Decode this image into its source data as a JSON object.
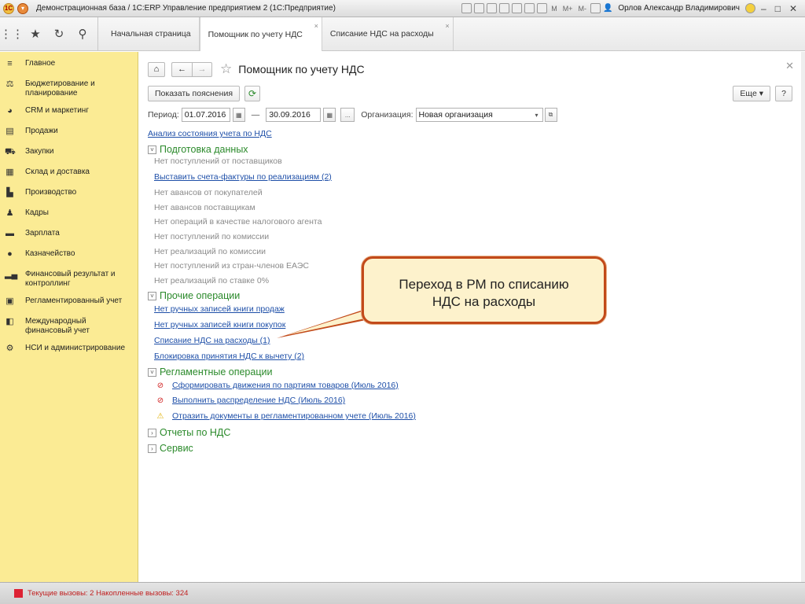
{
  "titlebar": {
    "title": "Демонстрационная база / 1С:ERP Управление предприятием 2  (1С:Предприятие)",
    "mem_labels": [
      "M",
      "M+",
      "M-"
    ],
    "user": "Орлов Александр Владимирович"
  },
  "tabs": [
    {
      "label": "Начальная страница"
    },
    {
      "label": "Помощник по учету НДС"
    },
    {
      "label": "Списание НДС на расходы"
    }
  ],
  "sidebar": {
    "items": [
      {
        "label": "Главное",
        "icon": "menu-icon"
      },
      {
        "label": "Бюджетирование и планирование",
        "icon": "budget-icon"
      },
      {
        "label": "CRM и маркетинг",
        "icon": "crm-icon"
      },
      {
        "label": "Продажи",
        "icon": "sales-icon"
      },
      {
        "label": "Закупки",
        "icon": "cart-icon"
      },
      {
        "label": "Склад и доставка",
        "icon": "warehouse-icon"
      },
      {
        "label": "Производство",
        "icon": "factory-icon"
      },
      {
        "label": "Кадры",
        "icon": "person-icon"
      },
      {
        "label": "Зарплата",
        "icon": "salary-icon"
      },
      {
        "label": "Казначейство",
        "icon": "treasury-icon"
      },
      {
        "label": "Финансовый результат и контроллинг",
        "icon": "chart-icon"
      },
      {
        "label": "Регламентированный учет",
        "icon": "calculator-icon"
      },
      {
        "label": "Международный финансовый учет",
        "icon": "ledger-icon"
      },
      {
        "label": "НСИ и администрирование",
        "icon": "gear-icon"
      }
    ]
  },
  "page": {
    "title": "Помощник по учету НДС",
    "show_hints_button": "Показать пояснения",
    "more_button": "Еще",
    "help_button": "?",
    "period_label": "Период:",
    "period_from": "01.07.2016",
    "period_dash": "—",
    "period_to": "30.09.2016",
    "period_more": "...",
    "org_label": "Организация:",
    "org_value": "Новая организация",
    "analysis_link": "Анализ состояния учета по НДС"
  },
  "groups": {
    "prep": {
      "title": "Подготовка данных",
      "items": [
        {
          "text": "Нет поступлений от поставщиков",
          "link": false
        },
        {
          "text": "Выставить счета-фактуры по реализациям (2)",
          "link": true
        },
        {
          "text": "Нет авансов от покупателей",
          "link": false
        },
        {
          "text": "Нет авансов поставщикам",
          "link": false
        },
        {
          "text": "Нет операций в качестве налогового агента",
          "link": false
        },
        {
          "text": "Нет поступлений по комиссии",
          "link": false
        },
        {
          "text": "Нет реализаций по комиссии",
          "link": false
        },
        {
          "text": "Нет поступлений из стран-членов ЕАЭС",
          "link": false
        },
        {
          "text": "Нет реализаций по ставке 0%",
          "link": false
        }
      ]
    },
    "other": {
      "title": "Прочие операции",
      "items": [
        {
          "text": "Нет ручных записей книги продаж",
          "link": true
        },
        {
          "text": "Нет ручных записей книги покупок",
          "link": true
        },
        {
          "text": "Списание НДС на расходы (1)",
          "link": true
        },
        {
          "text": "Блокировка принятия НДС к вычету (2)",
          "link": true
        }
      ]
    },
    "reg": {
      "title": "Регламентные операции",
      "items": [
        {
          "text": "Сформировать движения по партиям товаров (Июль 2016)",
          "status": "error"
        },
        {
          "text": "Выполнить распределение НДС (Июль 2016)",
          "status": "error"
        },
        {
          "text": "Отразить документы в регламентированном учете (Июль 2016)",
          "status": "warning"
        }
      ]
    },
    "reports": {
      "title": "Отчеты по НДС"
    },
    "service": {
      "title": "Сервис"
    }
  },
  "callout": {
    "line1": "Переход в РМ по списанию",
    "line2": "НДС на расходы"
  },
  "statusbar": {
    "text": "Текущие вызовы: 2   Накопленные вызовы: 324"
  },
  "colors": {
    "sidebar_bg": "#fbeb94",
    "link": "#1e4fa8",
    "group_title": "#2b8a2b",
    "callout_border": "#c24a1a",
    "callout_bg": "#fdf2cc",
    "error": "#d02020",
    "warning": "#e0b000"
  }
}
